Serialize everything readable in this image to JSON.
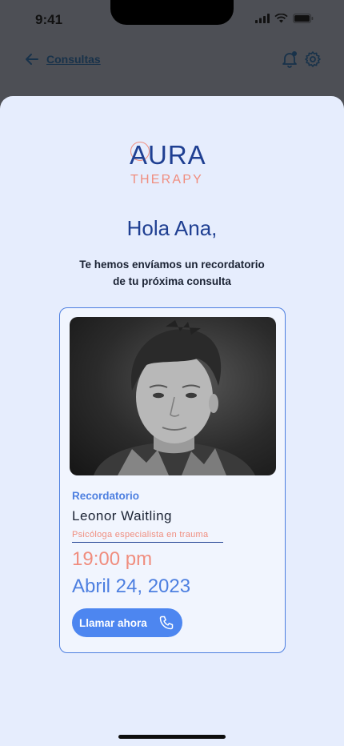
{
  "status_bar": {
    "time": "9:41"
  },
  "background_nav": {
    "back_label": "Consultas"
  },
  "logo": {
    "brand": "AURA",
    "tagline": "THERAPY"
  },
  "greeting": "Hola Ana,",
  "subtitle_line1": "Te hemos envíamos un recordatorio",
  "subtitle_line2": "de tu próxima consulta",
  "card": {
    "label": "Recordatorio",
    "name": "Leonor Waitling",
    "specialty": "Psicóloga especialista en trauma",
    "time": "19:00 pm",
    "date": "Abril 24, 2023",
    "call_label": "Llamar ahora"
  },
  "colors": {
    "navy": "#1f3f92",
    "accent_blue": "#4d7fe0",
    "coral": "#f08d7e",
    "sheet_bg": "#e6edfd"
  }
}
